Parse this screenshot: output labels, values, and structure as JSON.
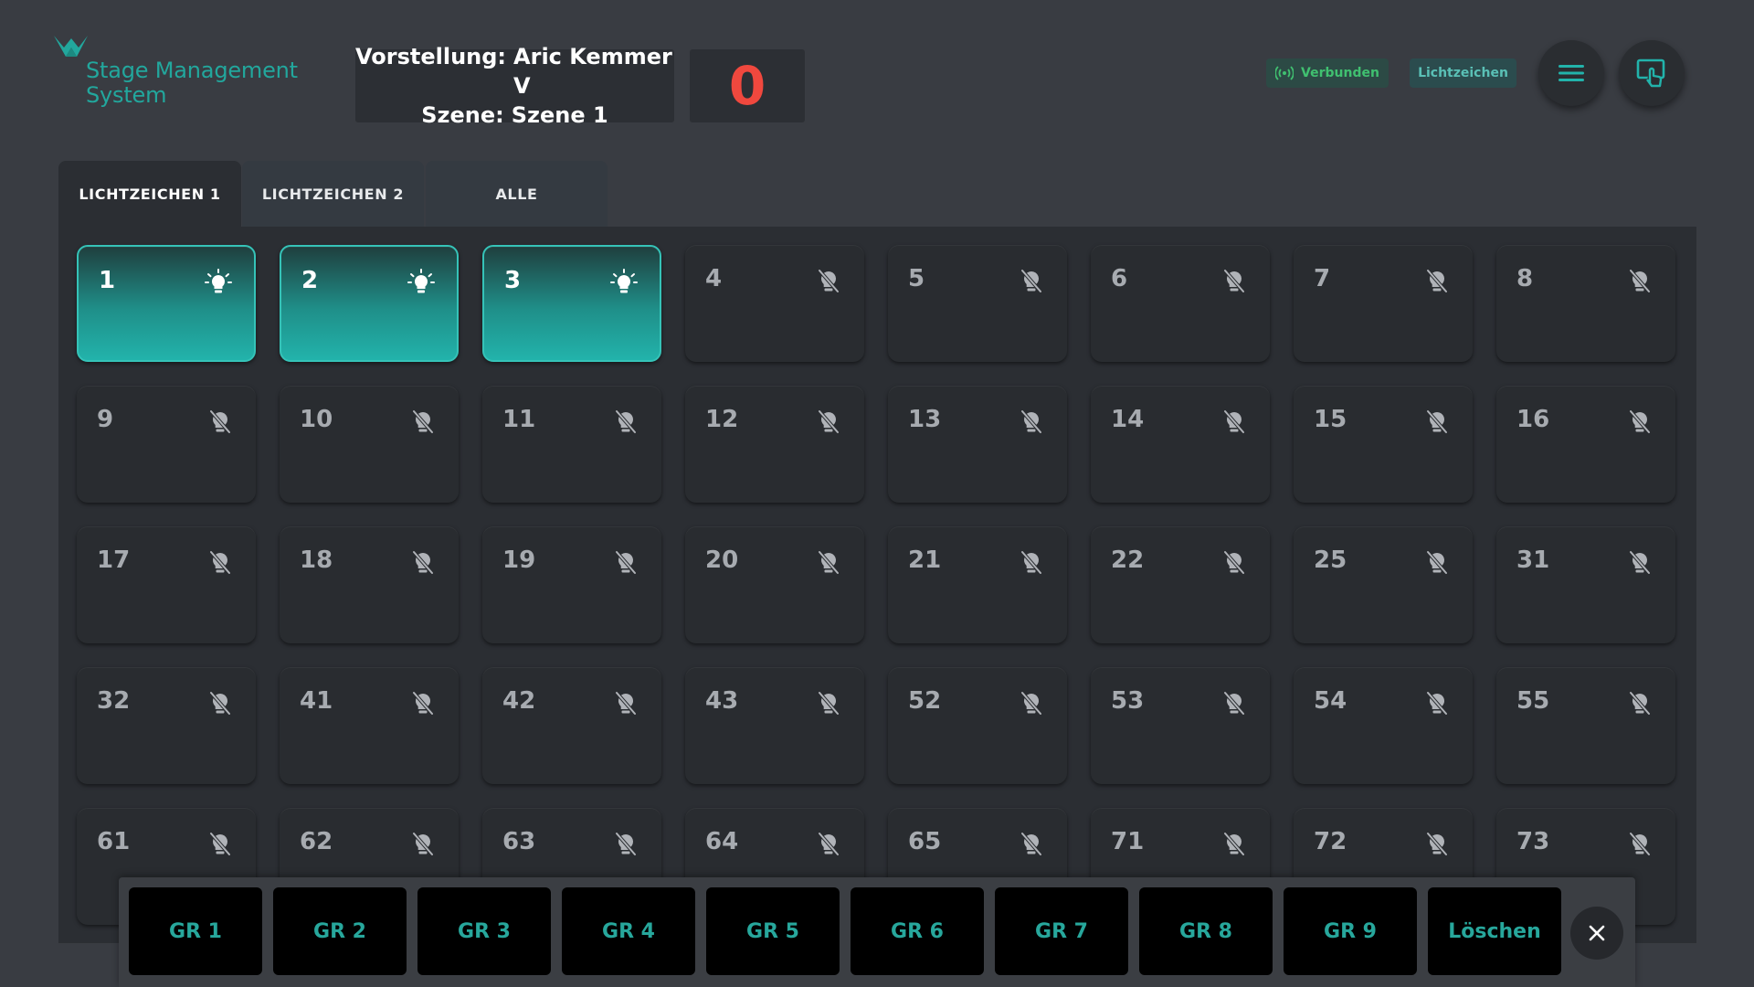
{
  "app": {
    "logo_line1": "Stage Management",
    "logo_line2": "System",
    "brand_color": "#22a79d"
  },
  "header": {
    "show_label": "Vorstellung:",
    "show_value": "Aric Kemmer V",
    "scene_label": "Szene:",
    "scene_value": "Szene 1",
    "counter": "0",
    "counter_color": "#f0483e",
    "status_badge": "Verbunden",
    "mode_badge": "Lichtzeichen",
    "menu_icon": "hamburger-menu-icon",
    "screen_icon": "screen-touch-icon"
  },
  "tabs": [
    {
      "label": "LICHTZEICHEN 1",
      "active": true
    },
    {
      "label": "LICHTZEICHEN 2",
      "active": false
    },
    {
      "label": "ALLE",
      "active": false
    }
  ],
  "cues": [
    {
      "num": "1",
      "on": true
    },
    {
      "num": "2",
      "on": true
    },
    {
      "num": "3",
      "on": true
    },
    {
      "num": "4",
      "on": false
    },
    {
      "num": "5",
      "on": false
    },
    {
      "num": "6",
      "on": false
    },
    {
      "num": "7",
      "on": false
    },
    {
      "num": "8",
      "on": false
    },
    {
      "num": "9",
      "on": false
    },
    {
      "num": "10",
      "on": false
    },
    {
      "num": "11",
      "on": false
    },
    {
      "num": "12",
      "on": false
    },
    {
      "num": "13",
      "on": false
    },
    {
      "num": "14",
      "on": false
    },
    {
      "num": "15",
      "on": false
    },
    {
      "num": "16",
      "on": false
    },
    {
      "num": "17",
      "on": false
    },
    {
      "num": "18",
      "on": false
    },
    {
      "num": "19",
      "on": false
    },
    {
      "num": "20",
      "on": false
    },
    {
      "num": "21",
      "on": false
    },
    {
      "num": "22",
      "on": false
    },
    {
      "num": "25",
      "on": false
    },
    {
      "num": "31",
      "on": false
    },
    {
      "num": "32",
      "on": false
    },
    {
      "num": "41",
      "on": false
    },
    {
      "num": "42",
      "on": false
    },
    {
      "num": "43",
      "on": false
    },
    {
      "num": "52",
      "on": false
    },
    {
      "num": "53",
      "on": false
    },
    {
      "num": "54",
      "on": false
    },
    {
      "num": "55",
      "on": false
    },
    {
      "num": "61",
      "on": false
    },
    {
      "num": "62",
      "on": false
    },
    {
      "num": "63",
      "on": false
    },
    {
      "num": "64",
      "on": false
    },
    {
      "num": "65",
      "on": false
    },
    {
      "num": "71",
      "on": false
    },
    {
      "num": "72",
      "on": false
    },
    {
      "num": "73",
      "on": false
    }
  ],
  "groups": [
    "GR 1",
    "GR 2",
    "GR 3",
    "GR 4",
    "GR 5",
    "GR 6",
    "GR 7",
    "GR 8",
    "GR 9",
    "Löschen"
  ],
  "colors": {
    "accent": "#22b3ab",
    "background": "#393c42",
    "panel": "#2b2e33"
  }
}
